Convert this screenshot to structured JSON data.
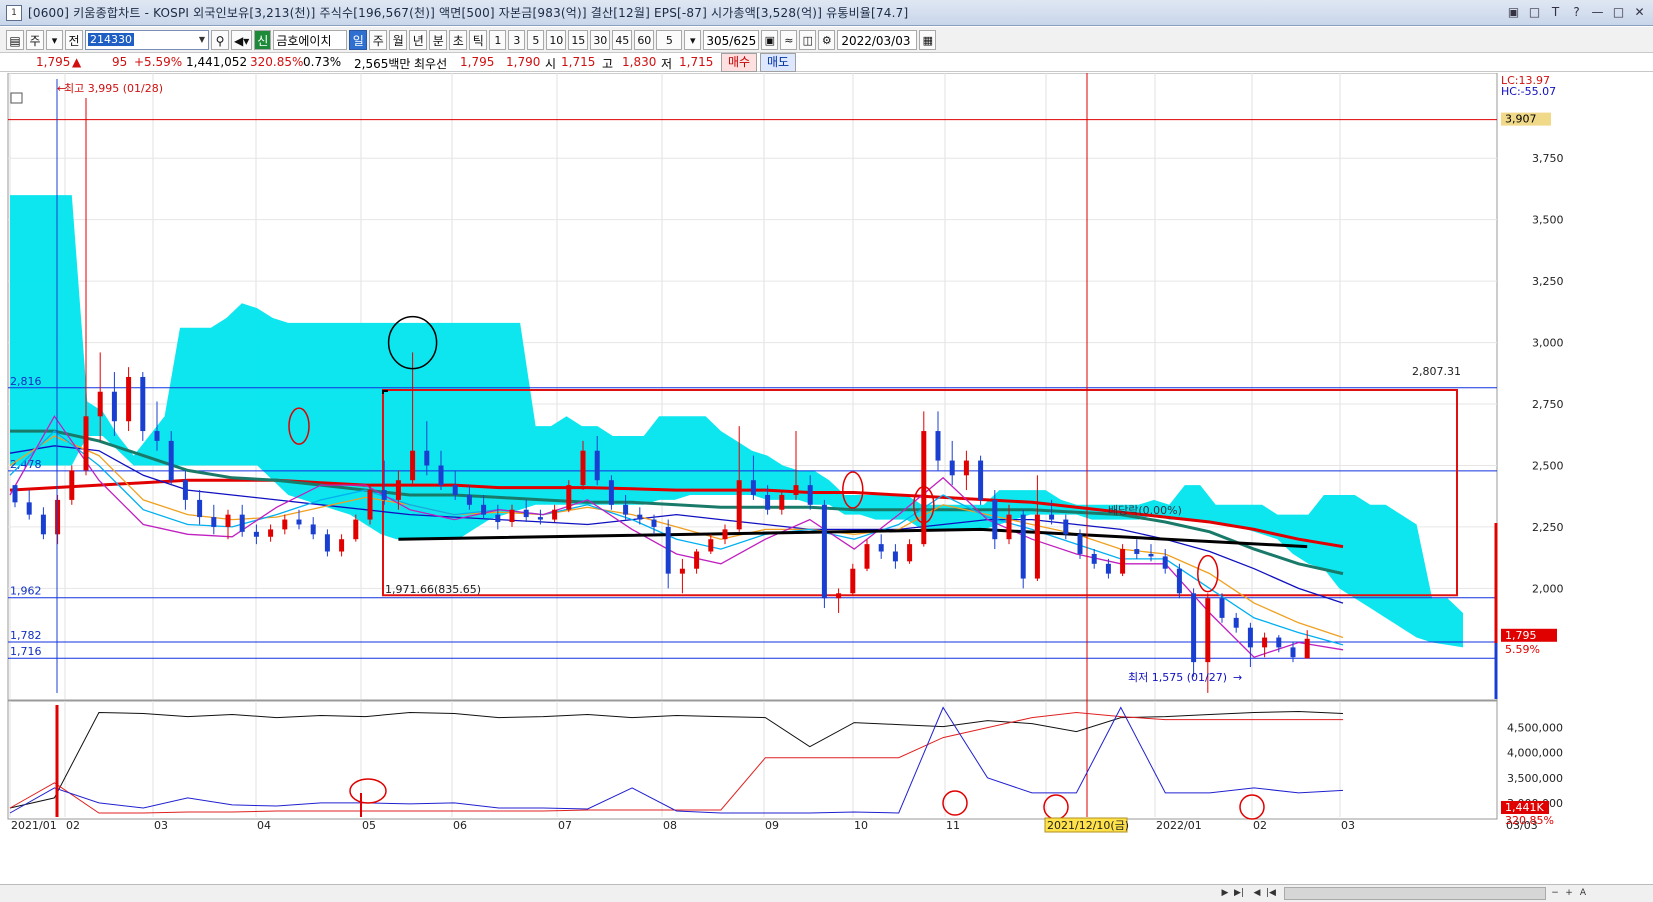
{
  "window": {
    "title": "[0600] 키움종합차트 - KOSPI 외국인보유[3,213(천)] 주식수[196,567(천)] 액면[500] 자본금[983(억)] 결산[12월] EPS[-87] 시가총액[3,528(억)] 유통비율[74.7]",
    "app_icon": "1",
    "buttons": [
      "▣",
      "□",
      "T",
      "?",
      "—",
      "□",
      "✕"
    ]
  },
  "toolbar": {
    "period_selector": "주",
    "jeon_label": "전",
    "stock_code": "214330",
    "stock_name": "금호에이치",
    "shin_label": "신",
    "timeframes": [
      "일",
      "주",
      "월",
      "년",
      "분",
      "초",
      "틱"
    ],
    "selected_timeframe": "일",
    "intervals": [
      "1",
      "3",
      "5",
      "10",
      "15",
      "30",
      "45",
      "60"
    ],
    "interval_value": "5",
    "count": "305/625",
    "date": "2022/03/03"
  },
  "quote": {
    "price": "1,795",
    "change_arrow": "▲",
    "change": "95",
    "change_pct": "+5.59%",
    "volume": "1,441,052",
    "volume_ratio": "320.85%",
    "turnover": "0.73%",
    "amount": "2,565백만",
    "best_label": "최우선",
    "ask": "1,795",
    "bid": "1,790",
    "open_label": "시",
    "open": "1,715",
    "high_label": "고",
    "high": "1,830",
    "low_label": "저",
    "low": "1,715",
    "buy_label": "매수",
    "sell_label": "매도"
  },
  "chart_data": {
    "type": "candlestick",
    "x_ticks": [
      "2021/01",
      "02",
      "03",
      "04",
      "05",
      "06",
      "07",
      "08",
      "09",
      "10",
      "11",
      "2021/12/10(금)",
      "2022/01",
      "02",
      "03"
    ],
    "right_date": "03/03",
    "price_axis": {
      "ticks": [
        3750,
        3500,
        3250,
        3000,
        2750,
        2500,
        2250,
        2000
      ],
      "tick_labels": [
        "3,750",
        "3,500",
        "3,250",
        "3,000",
        "2,750",
        "2,500",
        "2,250",
        "2,000"
      ],
      "range": [
        1550,
        4060
      ],
      "lc": "LC:13.97",
      "hc": "HC:-55.07",
      "top_badge": "3,907",
      "price_badge": "1,795",
      "pct_badge": "5.59%"
    },
    "annotations": {
      "high_label": "최고 3,995 (01/28)",
      "low_label": "최저 1,575 (01/27)",
      "box_top_label": "2,807.31",
      "box_bottom_label": "1,971.66(835.65)",
      "trend_label": "배당락(0.00%)"
    },
    "horizontal_lines": [
      {
        "label": "2,816",
        "value": 2816
      },
      {
        "label": "2,478",
        "value": 2478
      },
      {
        "label": "1,962",
        "value": 1962
      },
      {
        "label": "1,782",
        "value": 1782
      },
      {
        "label": "1,716",
        "value": 1716
      }
    ],
    "red_h_line": 3907,
    "box": {
      "top": 2807,
      "bottom": 1972
    },
    "candles": [
      [
        2420,
        2420,
        2330,
        2350
      ],
      [
        2350,
        2400,
        2280,
        2300
      ],
      [
        2300,
        2330,
        2200,
        2220
      ],
      [
        2220,
        2380,
        2180,
        2360
      ],
      [
        2360,
        2500,
        2340,
        2480
      ],
      [
        2480,
        3995,
        2460,
        2700
      ],
      [
        2700,
        2960,
        2600,
        2800
      ],
      [
        2800,
        2880,
        2620,
        2680
      ],
      [
        2680,
        2900,
        2640,
        2860
      ],
      [
        2860,
        2880,
        2600,
        2640
      ],
      [
        2640,
        2760,
        2560,
        2600
      ],
      [
        2600,
        2640,
        2420,
        2440
      ],
      [
        2440,
        2480,
        2320,
        2360
      ],
      [
        2360,
        2400,
        2260,
        2290
      ],
      [
        2290,
        2340,
        2220,
        2250
      ],
      [
        2250,
        2320,
        2200,
        2300
      ],
      [
        2300,
        2340,
        2210,
        2230
      ],
      [
        2230,
        2260,
        2180,
        2210
      ],
      [
        2210,
        2260,
        2190,
        2240
      ],
      [
        2240,
        2300,
        2220,
        2280
      ],
      [
        2280,
        2320,
        2240,
        2260
      ],
      [
        2260,
        2290,
        2200,
        2220
      ],
      [
        2220,
        2240,
        2130,
        2150
      ],
      [
        2150,
        2220,
        2130,
        2200
      ],
      [
        2200,
        2300,
        2190,
        2280
      ],
      [
        2280,
        2420,
        2260,
        2400
      ],
      [
        2400,
        2520,
        2340,
        2360
      ],
      [
        2360,
        2480,
        2320,
        2440
      ],
      [
        2440,
        2960,
        2420,
        2560
      ],
      [
        2560,
        2680,
        2460,
        2500
      ],
      [
        2500,
        2560,
        2400,
        2420
      ],
      [
        2420,
        2480,
        2360,
        2380
      ],
      [
        2380,
        2420,
        2320,
        2340
      ],
      [
        2340,
        2380,
        2280,
        2300
      ],
      [
        2300,
        2340,
        2240,
        2270
      ],
      [
        2270,
        2340,
        2250,
        2320
      ],
      [
        2320,
        2360,
        2270,
        2290
      ],
      [
        2290,
        2320,
        2260,
        2280
      ],
      [
        2280,
        2340,
        2270,
        2320
      ],
      [
        2320,
        2440,
        2310,
        2420
      ],
      [
        2420,
        2600,
        2400,
        2560
      ],
      [
        2560,
        2620,
        2420,
        2440
      ],
      [
        2440,
        2460,
        2320,
        2340
      ],
      [
        2340,
        2380,
        2280,
        2300
      ],
      [
        2300,
        2330,
        2260,
        2280
      ],
      [
        2280,
        2300,
        2220,
        2250
      ],
      [
        2250,
        2280,
        2000,
        2060
      ],
      [
        2060,
        2120,
        1980,
        2080
      ],
      [
        2080,
        2160,
        2060,
        2150
      ],
      [
        2150,
        2220,
        2140,
        2200
      ],
      [
        2200,
        2260,
        2180,
        2240
      ],
      [
        2240,
        2660,
        2230,
        2440
      ],
      [
        2440,
        2540,
        2360,
        2380
      ],
      [
        2380,
        2420,
        2300,
        2320
      ],
      [
        2320,
        2400,
        2300,
        2380
      ],
      [
        2380,
        2640,
        2360,
        2420
      ],
      [
        2420,
        2460,
        2320,
        2340
      ],
      [
        2340,
        2360,
        1920,
        1960
      ],
      [
        1960,
        2000,
        1900,
        1980
      ],
      [
        1980,
        2100,
        1970,
        2080
      ],
      [
        2080,
        2200,
        2070,
        2180
      ],
      [
        2180,
        2220,
        2120,
        2150
      ],
      [
        2150,
        2180,
        2080,
        2110
      ],
      [
        2110,
        2200,
        2100,
        2180
      ],
      [
        2180,
        2720,
        2170,
        2640
      ],
      [
        2640,
        2720,
        2480,
        2520
      ],
      [
        2520,
        2600,
        2420,
        2460
      ],
      [
        2460,
        2560,
        2400,
        2520
      ],
      [
        2520,
        2540,
        2340,
        2360
      ],
      [
        2360,
        2400,
        2160,
        2200
      ],
      [
        2200,
        2340,
        2180,
        2300
      ],
      [
        2300,
        2320,
        2000,
        2040
      ],
      [
        2040,
        2460,
        2030,
        2300
      ],
      [
        2300,
        2360,
        2260,
        2280
      ],
      [
        2280,
        2300,
        2200,
        2220
      ],
      [
        2220,
        2240,
        2120,
        2140
      ],
      [
        2140,
        2160,
        2080,
        2100
      ],
      [
        2100,
        2120,
        2040,
        2060
      ],
      [
        2060,
        2180,
        2050,
        2160
      ],
      [
        2160,
        2200,
        2120,
        2140
      ],
      [
        2140,
        2180,
        2110,
        2130
      ],
      [
        2130,
        2160,
        2060,
        2080
      ],
      [
        2080,
        2100,
        1960,
        1980
      ],
      [
        1980,
        2000,
        1640,
        1700
      ],
      [
        1700,
        1980,
        1575,
        1960
      ],
      [
        1960,
        1980,
        1860,
        1880
      ],
      [
        1880,
        1900,
        1820,
        1840
      ],
      [
        1840,
        1860,
        1680,
        1760
      ],
      [
        1760,
        1820,
        1720,
        1800
      ],
      [
        1800,
        1810,
        1740,
        1760
      ],
      [
        1760,
        1780,
        1700,
        1720
      ],
      [
        1715,
        1830,
        1715,
        1795
      ]
    ],
    "moving_averages": [
      {
        "color": "#e00000",
        "width": 3,
        "values": [
          2400,
          2410,
          2420,
          2430,
          2440,
          2440,
          2440,
          2430,
          2420,
          2420,
          2420,
          2410,
          2410,
          2410,
          2405,
          2400,
          2400,
          2400,
          2390,
          2390,
          2380,
          2370,
          2360,
          2350,
          2330,
          2310,
          2290,
          2270,
          2240,
          2200,
          2170
        ]
      },
      {
        "color": "#1a7a6a",
        "width": 3,
        "values": [
          2640,
          2640,
          2600,
          2540,
          2480,
          2450,
          2440,
          2420,
          2400,
          2380,
          2380,
          2370,
          2360,
          2350,
          2350,
          2340,
          2330,
          2330,
          2330,
          2320,
          2320,
          2320,
          2320,
          2320,
          2310,
          2300,
          2270,
          2230,
          2160,
          2100,
          2060
        ]
      },
      {
        "color": "#1010c0",
        "width": 1.3,
        "values": [
          2550,
          2580,
          2560,
          2460,
          2400,
          2380,
          2360,
          2340,
          2320,
          2300,
          2290,
          2280,
          2270,
          2260,
          2280,
          2300,
          2280,
          2260,
          2240,
          2240,
          2240,
          2260,
          2280,
          2280,
          2260,
          2240,
          2200,
          2150,
          2080,
          2000,
          1940
        ]
      },
      {
        "color": "#f0a020",
        "width": 1.3,
        "values": [
          2500,
          2620,
          2540,
          2360,
          2300,
          2280,
          2290,
          2330,
          2370,
          2340,
          2300,
          2310,
          2300,
          2330,
          2300,
          2250,
          2200,
          2240,
          2240,
          2220,
          2240,
          2340,
          2300,
          2260,
          2220,
          2160,
          2140,
          2060,
          1940,
          1860,
          1800
        ]
      },
      {
        "color": "#00b0f0",
        "width": 1.3,
        "values": [
          2460,
          2640,
          2500,
          2320,
          2260,
          2250,
          2300,
          2360,
          2400,
          2340,
          2300,
          2320,
          2300,
          2340,
          2280,
          2200,
          2160,
          2220,
          2240,
          2200,
          2260,
          2380,
          2290,
          2240,
          2180,
          2120,
          2120,
          2000,
          1880,
          1820,
          1770
        ]
      },
      {
        "color": "#c020c0",
        "width": 1.3,
        "values": [
          2380,
          2700,
          2440,
          2260,
          2220,
          2210,
          2330,
          2420,
          2420,
          2320,
          2280,
          2320,
          2300,
          2360,
          2240,
          2140,
          2100,
          2200,
          2280,
          2160,
          2300,
          2450,
          2280,
          2200,
          2140,
          2100,
          2100,
          1900,
          1720,
          1780,
          1750
        ]
      }
    ],
    "black_trend_line": [
      [
        27,
        2200
      ],
      [
        68,
        2240
      ],
      [
        91,
        2170
      ]
    ],
    "ichimoku_cloud": {
      "color": "#00e5ee",
      "upper": [
        3600,
        3600,
        3600,
        3600,
        3600,
        2760,
        2720,
        2620,
        2540,
        2620,
        2700,
        3060,
        3060,
        3060,
        3100,
        3160,
        3140,
        3100,
        3080,
        3080,
        3080,
        3080,
        3080,
        3080,
        3080,
        3080,
        3080,
        3080,
        3080,
        3080,
        3080,
        3080,
        3080,
        3080,
        2660,
        2660,
        2700,
        2660,
        2660,
        2620,
        2620,
        2620,
        2700,
        2700,
        2700,
        2700,
        2640,
        2600,
        2560,
        2540,
        2500,
        2480,
        2480,
        2440,
        2380,
        2380,
        2380,
        2380,
        2380,
        2340,
        2340,
        2340,
        2340,
        2340,
        2400,
        2400,
        2400,
        2400,
        2360,
        2340,
        2340,
        2340,
        2340,
        2340,
        2360,
        2340,
        2420,
        2420,
        2340,
        2340,
        2340,
        2340,
        2300,
        2300,
        2300,
        2380,
        2380,
        2380,
        2340,
        2340,
        2300,
        2260,
        1960,
        1960,
        1900
      ],
      "lower": [
        2500,
        2500,
        2500,
        2500,
        2500,
        2620,
        2620,
        2560,
        2500,
        2500,
        2500,
        2500,
        2500,
        2500,
        2500,
        2500,
        2500,
        2440,
        2380,
        2360,
        2340,
        2320,
        2300,
        2260,
        2220,
        2200,
        2200,
        2200,
        2200,
        2200,
        2240,
        2280,
        2300,
        2320,
        2340,
        2340,
        2340,
        2340,
        2340,
        2340,
        2340,
        2340,
        2360,
        2360,
        2380,
        2380,
        2380,
        2380,
        2380,
        2360,
        2360,
        2360,
        2340,
        2340,
        2300,
        2300,
        2280,
        2280,
        2280,
        2240,
        2240,
        2240,
        2240,
        2240,
        2260,
        2280,
        2300,
        2300,
        2300,
        2300,
        2280,
        2280,
        2280,
        2280,
        2300,
        2280,
        2280,
        2280,
        2260,
        2260,
        2240,
        2220,
        2200,
        2140,
        2100,
        2080,
        2000,
        1960,
        1920,
        1880,
        1840,
        1800,
        1780,
        1770,
        1760
      ]
    },
    "red_circles": [
      [
        20,
        2660
      ],
      [
        59,
        2400
      ],
      [
        64,
        2340
      ],
      [
        84,
        2060
      ]
    ],
    "black_circle": [
      28,
      3000
    ],
    "volume_panel": {
      "ticks": [
        "4,500,000",
        "4,000,000",
        "3,500,000",
        "3,000,000"
      ],
      "tick_values": [
        4500000,
        4000000,
        3500000,
        3000000
      ],
      "range": [
        2720000,
        4950000
      ],
      "volume_badge": "1,441K",
      "ratio_badge": "320.85%",
      "black_line": [
        2900000,
        3100000,
        4800000,
        4780000,
        4720000,
        4760000,
        4700000,
        4740000,
        4720000,
        4800000,
        4780000,
        4700000,
        4720000,
        4760000,
        4700000,
        4740000,
        4720000,
        4700000,
        4120000,
        4600000,
        4560000,
        4520000,
        4640000,
        4580000,
        4420000,
        4700000,
        4720000,
        4760000,
        4800000,
        4820000,
        4780000
      ],
      "red_line": [
        2900000,
        3400000,
        2800000,
        2800000,
        2820000,
        2820000,
        2840000,
        2840000,
        2840000,
        2840000,
        2840000,
        2840000,
        2840000,
        2860000,
        2860000,
        2860000,
        2860000,
        3900000,
        3900000,
        3900000,
        3900000,
        4300000,
        4500000,
        4700000,
        4800000,
        4720000,
        4660000,
        4660000,
        4660000,
        4660000,
        4660000
      ],
      "blue_line": [
        2800000,
        3300000,
        3000000,
        2900000,
        3100000,
        2960000,
        2940000,
        3000000,
        3000000,
        2980000,
        3000000,
        2900000,
        2900000,
        2880000,
        3300000,
        2840000,
        2800000,
        2800000,
        2800000,
        2820000,
        2800000,
        4900000,
        3500000,
        3200000,
        3200000,
        4900000,
        3200000,
        3200000,
        3300000,
        3200000,
        3250000
      ]
    }
  }
}
